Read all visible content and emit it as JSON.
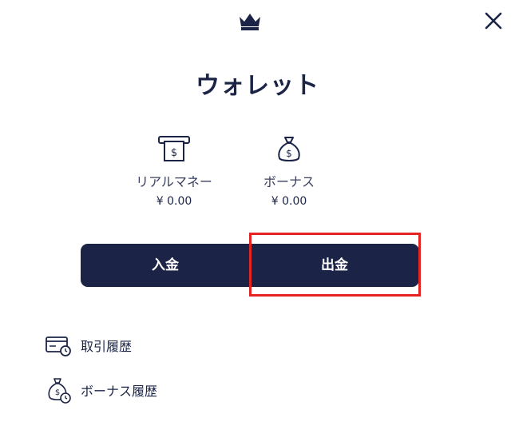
{
  "header": {
    "logo_icon": "crown-icon",
    "close_icon": "close-icon"
  },
  "wallet": {
    "title": "ウォレット",
    "real_money": {
      "icon": "atm-cash-icon",
      "label": "リアルマネー",
      "amount": "¥ 0.00"
    },
    "bonus": {
      "icon": "money-bag-icon",
      "label": "ボーナス",
      "amount": "¥ 0.00"
    }
  },
  "actions": {
    "deposit_label": "入金",
    "withdraw_label": "出金",
    "highlighted": "withdraw"
  },
  "menu": {
    "items": [
      {
        "icon": "card-history-icon",
        "label": "取引履歴"
      },
      {
        "icon": "bonus-history-icon",
        "label": "ボーナス履歴"
      }
    ]
  },
  "colors": {
    "primary": "#1b2447",
    "highlight": "#e52323",
    "background": "#ffffff"
  }
}
